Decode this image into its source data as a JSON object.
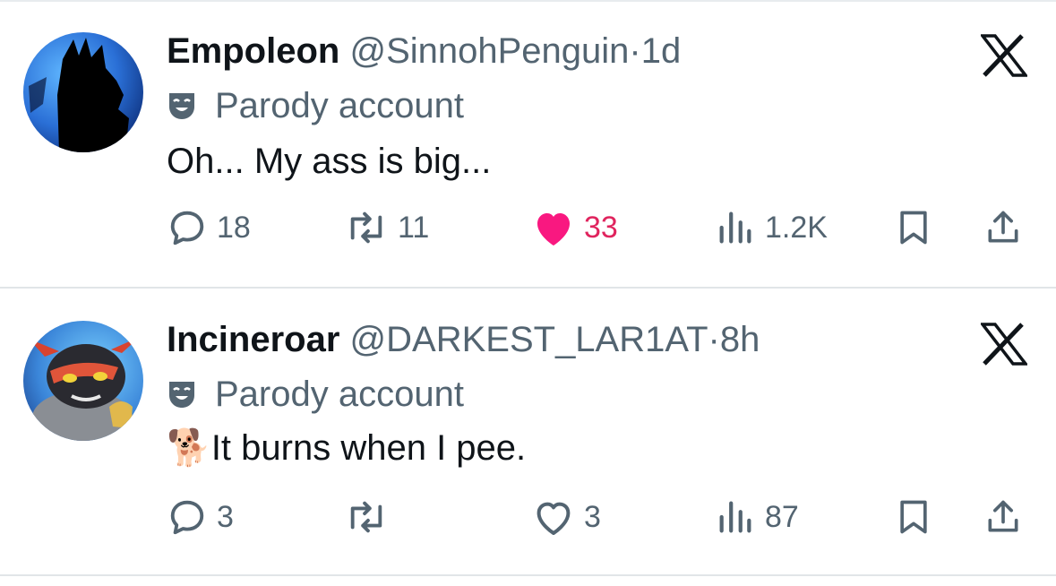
{
  "colors": {
    "text": "#0f1419",
    "muted": "#536471",
    "like": "#f91880",
    "divider": "#e1e5e8"
  },
  "posts": [
    {
      "name": "Empoleon",
      "handle": "@SinnohPenguin",
      "separator": "·",
      "time": "1d",
      "parody_label": "Parody account",
      "text": "Oh... My ass is big...",
      "replies": "18",
      "reposts": "11",
      "likes": "33",
      "liked": true,
      "views": "1.2K",
      "avatar_icon": "empoleon-silhouette-avatar"
    },
    {
      "name": "Incineroar",
      "handle": "@DARKEST_LAR1AT",
      "separator": "·",
      "time": "8h",
      "parody_label": "Parody account",
      "emoji": "🐕",
      "text": "It burns when I pee.",
      "replies": "3",
      "reposts": "",
      "likes": "3",
      "liked": false,
      "views": "87",
      "avatar_icon": "incineroar-avatar"
    }
  ]
}
